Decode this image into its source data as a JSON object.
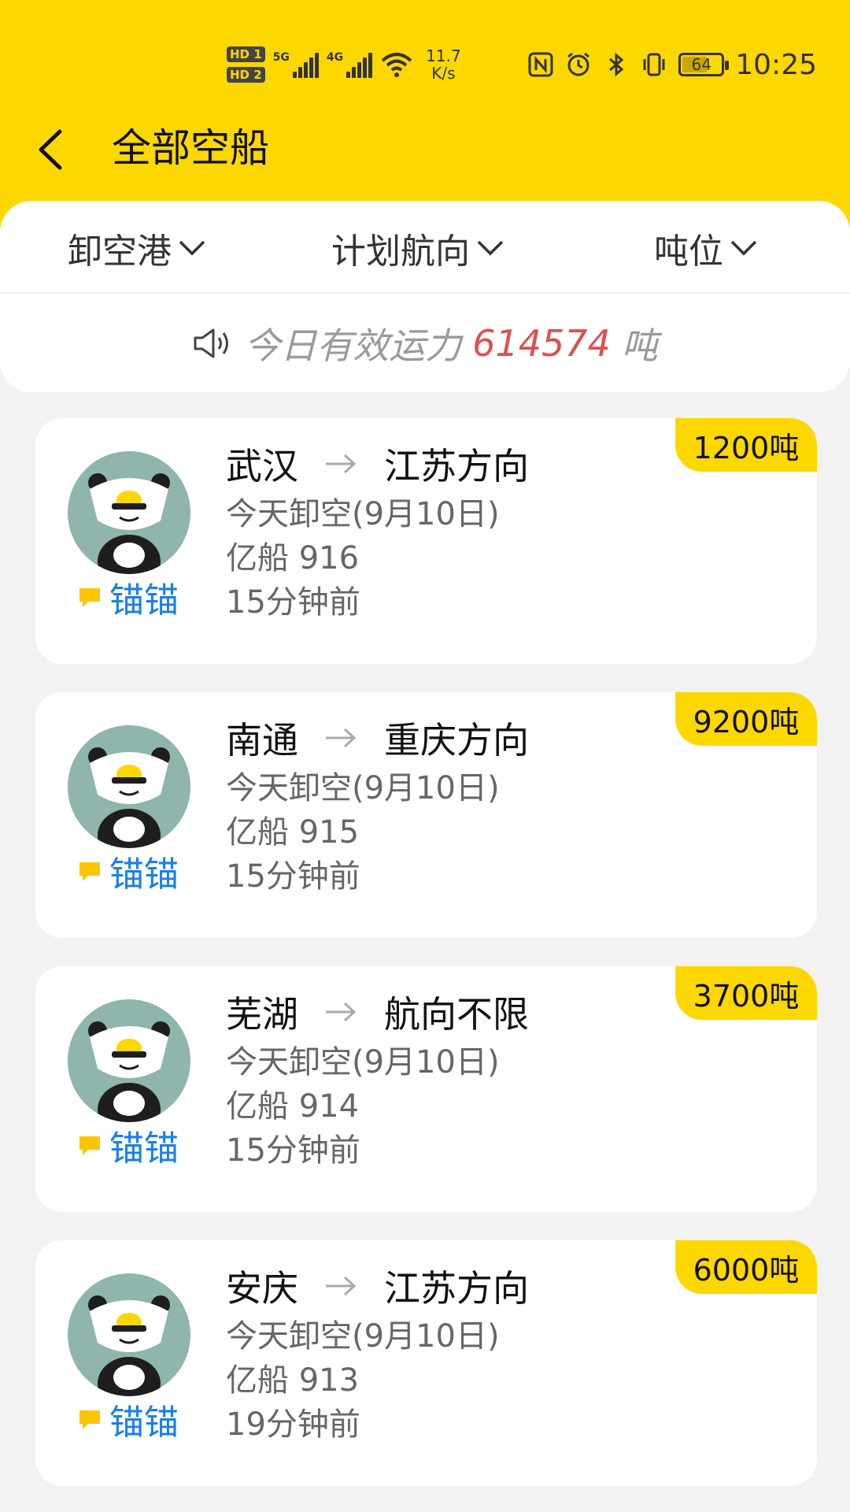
{
  "status_bar": {
    "hd1": "HD 1",
    "hd2": "HD 2",
    "net1": "5G",
    "net2": "4G",
    "speed_value": "11.7",
    "speed_unit": "K/s",
    "battery": "64",
    "time": "10:25",
    "icons": [
      "nfc-icon",
      "alarm-icon",
      "bluetooth-icon",
      "vibrate-icon",
      "battery-icon"
    ]
  },
  "header": {
    "title": "全部空船"
  },
  "filters": [
    {
      "label": "卸空港"
    },
    {
      "label": "计划航向"
    },
    {
      "label": "吨位"
    }
  ],
  "notice": {
    "text": "今日有效运力",
    "value": "614574",
    "unit": "吨"
  },
  "ships": [
    {
      "from": "武汉",
      "to": "江苏方向",
      "unload": "今天卸空(9月10日)",
      "name": "亿船 916",
      "time": "15分钟前",
      "tonnage": "1200吨",
      "owner": "锚锚"
    },
    {
      "from": "南通",
      "to": "重庆方向",
      "unload": "今天卸空(9月10日)",
      "name": "亿船 915",
      "time": "15分钟前",
      "tonnage": "9200吨",
      "owner": "锚锚"
    },
    {
      "from": "芜湖",
      "to": "航向不限",
      "unload": "今天卸空(9月10日)",
      "name": "亿船 914",
      "time": "15分钟前",
      "tonnage": "3700吨",
      "owner": "锚锚"
    },
    {
      "from": "安庆",
      "to": "江苏方向",
      "unload": "今天卸空(9月10日)",
      "name": "亿船 913",
      "time": "19分钟前",
      "tonnage": "6000吨",
      "owner": "锚锚"
    }
  ],
  "colors": {
    "brand_yellow": "#fdd700",
    "highlight_red": "#e04e4e",
    "owner_blue": "#1a7fe8"
  }
}
